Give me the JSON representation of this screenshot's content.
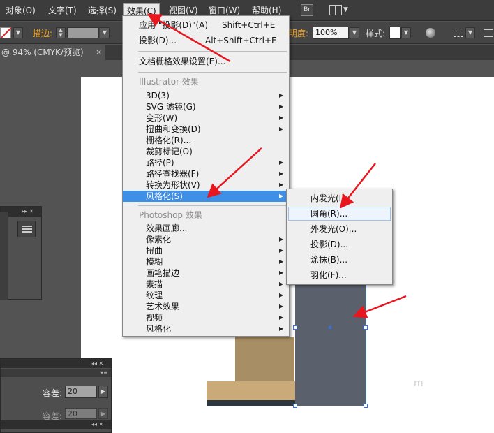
{
  "menubar": {
    "items": [
      "对象(O)",
      "文字(T)",
      "选择(S)",
      "效果(C)",
      "视图(V)",
      "窗口(W)",
      "帮助(H)"
    ],
    "bridge_badge": "Br"
  },
  "controlbar": {
    "stroke_label": "描边:",
    "opacity_label": "明度:",
    "opacity_value": "100%",
    "style_label": "样式:"
  },
  "tab": {
    "title": "@ 94% (CMYK/预览)",
    "close": "×"
  },
  "effect_menu": {
    "apply_label": "应用  \"投影(D)\"(A)",
    "apply_shortcut": "Shift+Ctrl+E",
    "shadow_label": "投影(D)...",
    "shadow_shortcut": "Alt+Shift+Ctrl+E",
    "doc_raster": "文档栅格效果设置(E)...",
    "illustrator_header": "Illustrator 效果",
    "illustrator_items": [
      "3D(3)",
      "SVG 滤镜(G)",
      "变形(W)",
      "扭曲和变换(D)",
      "栅格化(R)...",
      "裁剪标记(O)",
      "路径(P)",
      "路径查找器(F)",
      "转换为形状(V)",
      "风格化(S)"
    ],
    "photoshop_header": "Photoshop 效果",
    "photoshop_items": [
      "效果画廊...",
      "像素化",
      "扭曲",
      "模糊",
      "画笔描边",
      "素描",
      "纹理",
      "艺术效果",
      "视频",
      "风格化"
    ]
  },
  "stylize_submenu": {
    "items": [
      "内发光(I)...",
      "圆角(R)...",
      "外发光(O)...",
      "投影(D)...",
      "涂抹(B)...",
      "羽化(F)..."
    ],
    "highlighted_index": 1
  },
  "left_panel": {
    "tolerance_label": "容差:",
    "tolerance_value_1": "20",
    "tolerance_value_2": "20"
  },
  "watermark": "ⅿ",
  "colors": {
    "highlight": "#3e8fe6",
    "arrow": "#e8171f",
    "board": "#5b616c",
    "easel_wood": "#c9aa78"
  }
}
